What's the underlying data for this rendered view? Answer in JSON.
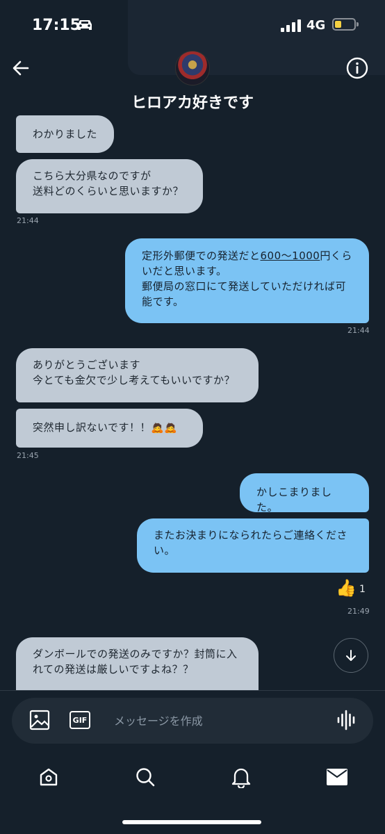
{
  "status": {
    "time": "17:15",
    "network": "4G"
  },
  "header": {
    "title": "ヒロアカ好きです"
  },
  "messages": [
    {
      "text": "わかりました"
    },
    {
      "text": "こちら大分県なのですが\n送料どのくらいと思いますか？"
    },
    {
      "time": "21:44"
    },
    {
      "text_before": "定形外郵便での発送だと",
      "link": "600〜1000",
      "text_after": "円くらいだと思います。\n郵便局の窓口にて発送していただければ可能です。"
    },
    {
      "time": "21:44"
    },
    {
      "text": "ありがとうございます\n今とても金欠で少し考えてもいいですか？"
    },
    {
      "text": "突然申し訳ないです！！🙇🙇"
    },
    {
      "time": "21:45"
    },
    {
      "text": "かしこまりました。"
    },
    {
      "text": "またお決まりになられたらご連絡ください。"
    },
    {
      "time": "21:49"
    },
    {
      "text": "ダンボールでの発送のみですか？封筒に入れての発送は厳しいですよね？？"
    }
  ],
  "reaction": {
    "emoji": "👍",
    "count": "1"
  },
  "composer": {
    "placeholder": "メッセージを作成",
    "gif_label": "GIF"
  },
  "icons": [
    "car-icon",
    "back-icon",
    "info-icon",
    "image-icon",
    "gif-icon",
    "voice-icon",
    "arrow-down-icon",
    "home-icon",
    "search-icon",
    "bell-icon",
    "mail-icon"
  ],
  "colors": {
    "background": "#15202b",
    "incoming": "#c0cad5",
    "outgoing": "#7bc3f4"
  }
}
